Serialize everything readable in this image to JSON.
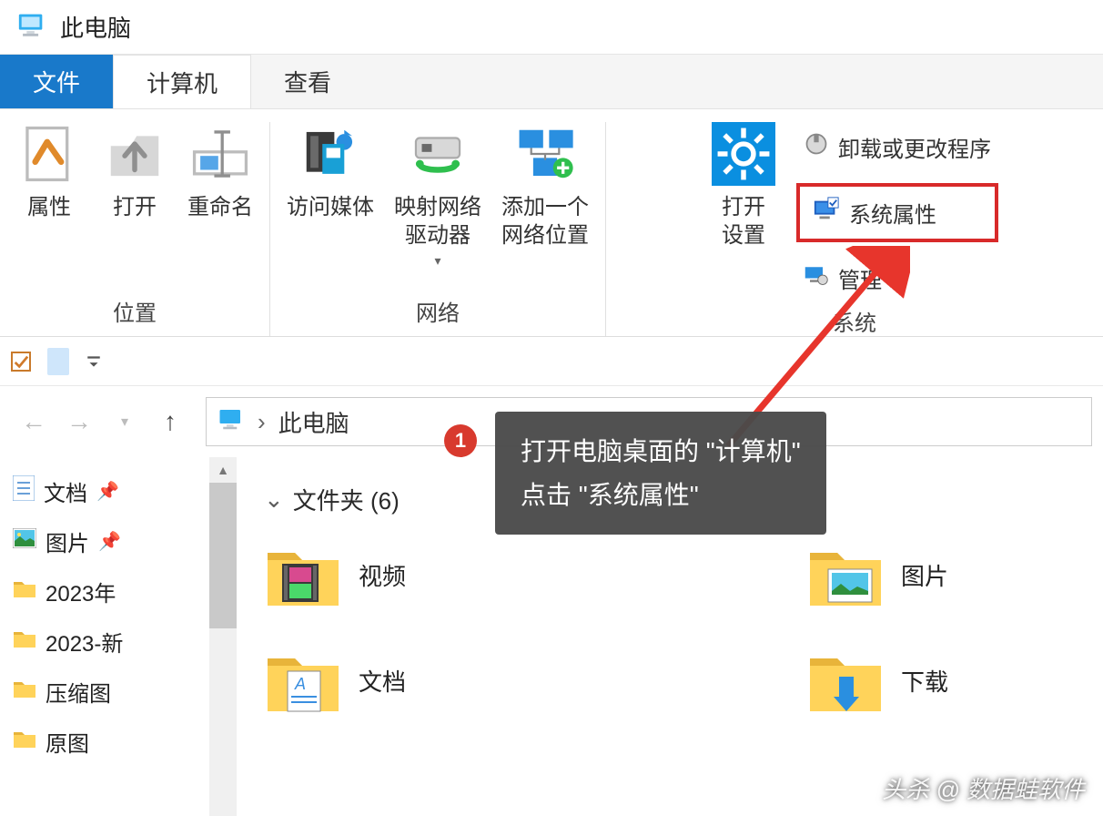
{
  "titlebar": {
    "title": "此电脑"
  },
  "tabs": {
    "file": "文件",
    "computer": "计算机",
    "view": "查看"
  },
  "ribbon": {
    "group1": {
      "title": "位置",
      "properties": "属性",
      "open": "打开",
      "rename": "重命名"
    },
    "group2": {
      "title": "网络",
      "media": "访问媒体",
      "map_drive": "映射网络\n驱动器",
      "add_loc": "添加一个\n网络位置"
    },
    "group3": {
      "title": "系统",
      "open_settings": "打开\n设置",
      "uninstall": "卸载或更改程序",
      "sys_props": "系统属性",
      "manage": "管理"
    }
  },
  "addressbar": {
    "location": "此电脑"
  },
  "sidebar": {
    "items": [
      {
        "label": "文档",
        "pinned": true,
        "icon": "doc"
      },
      {
        "label": "图片",
        "pinned": true,
        "icon": "pic"
      },
      {
        "label": "2023年",
        "pinned": false,
        "icon": "folder"
      },
      {
        "label": "2023-新",
        "pinned": false,
        "icon": "folder"
      },
      {
        "label": "压缩图",
        "pinned": false,
        "icon": "folder"
      },
      {
        "label": "原图",
        "pinned": false,
        "icon": "folder"
      }
    ]
  },
  "content": {
    "section": "文件夹 (6)",
    "folders": [
      {
        "label": "视频",
        "icon": "video"
      },
      {
        "label": "图片",
        "icon": "pictures"
      },
      {
        "label": "文档",
        "icon": "docs"
      },
      {
        "label": "下载",
        "icon": "download"
      }
    ]
  },
  "annotation": {
    "step": "1",
    "line1": "打开电脑桌面的 \"计算机\"",
    "line2": "点击 \"系统属性\""
  },
  "watermark": "头杀 @ 数据蛙软件"
}
